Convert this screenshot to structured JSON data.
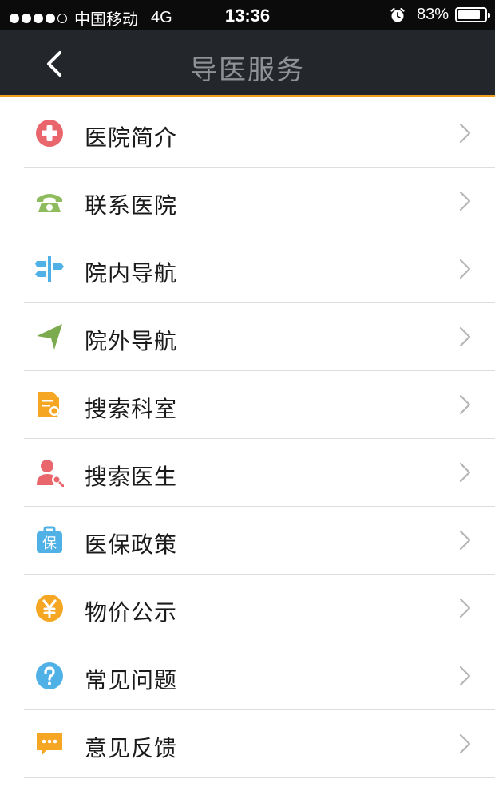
{
  "status_bar": {
    "carrier": "中国移动",
    "network": "4G",
    "time": "13:36",
    "battery": "83%",
    "battery_level": 0.83,
    "signal_bars": 4,
    "signal_max": 5
  },
  "nav": {
    "title": "导医服务",
    "back_icon": "chevron-left-icon"
  },
  "menu": [
    {
      "label": "医院简介",
      "icon": "hospital-cross-icon",
      "color": "#e9676c"
    },
    {
      "label": "联系医院",
      "icon": "telephone-icon",
      "color": "#8dbb5d"
    },
    {
      "label": "院内导航",
      "icon": "signpost-icon",
      "color": "#4fb1e6"
    },
    {
      "label": "院外导航",
      "icon": "location-arrow-icon",
      "color": "#7cab4f"
    },
    {
      "label": "搜索科室",
      "icon": "department-search-icon",
      "color": "#f5a623"
    },
    {
      "label": "搜索医生",
      "icon": "doctor-search-icon",
      "color": "#e9676c"
    },
    {
      "label": "医保政策",
      "icon": "insurance-bag-icon",
      "color": "#4fb1e6"
    },
    {
      "label": "物价公示",
      "icon": "yuan-coin-icon",
      "color": "#f5a623"
    },
    {
      "label": "常见问题",
      "icon": "question-icon",
      "color": "#4fb1e6"
    },
    {
      "label": "意见反馈",
      "icon": "feedback-chat-icon",
      "color": "#f5a623"
    }
  ],
  "colors": {
    "nav_background": "#23262a",
    "nav_accent": "#f0a01e",
    "nav_title": "#8e9196",
    "chevron": "#b5b5b5"
  }
}
